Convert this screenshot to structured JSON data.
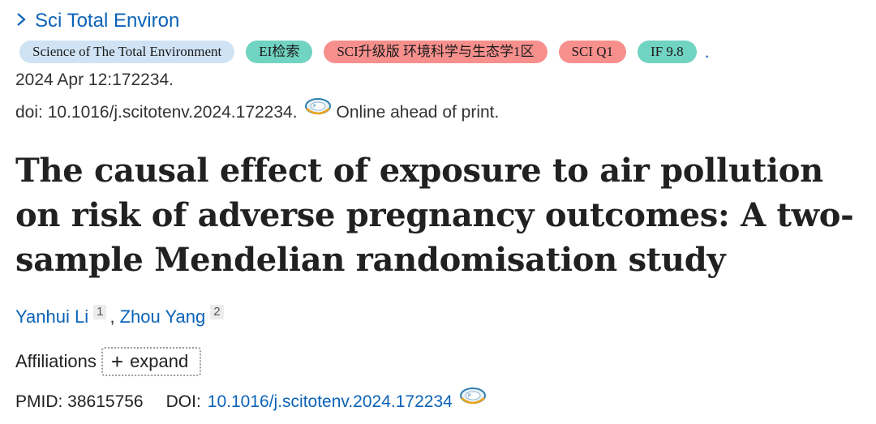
{
  "journal": {
    "short_name": "Sci Total Environ"
  },
  "badges": [
    {
      "label": "Science of The Total Environment",
      "color": "#cfe3f5"
    },
    {
      "label": "EI检索",
      "color": "#71d3c2"
    },
    {
      "label": "SCI升级版 环境科学与生态学1区",
      "color": "#f7908d"
    },
    {
      "label": "SCI Q1",
      "color": "#f7908d"
    },
    {
      "label": "IF 9.8",
      "color": "#71d3c2"
    }
  ],
  "badges_trailing": ".",
  "citation": {
    "date": "2024 Apr 12:172234.",
    "doi_text": "doi: 10.1016/j.scitotenv.2024.172234.",
    "status": "Online ahead of print."
  },
  "article": {
    "title": "The causal effect of exposure to air pollution on risk of adverse pregnancy outcomes: A two-sample Mendelian randomisation study"
  },
  "authors": [
    {
      "name": "Yanhui Li",
      "affiliation": "1"
    },
    {
      "name": "Zhou Yang",
      "affiliation": "2"
    }
  ],
  "author_separator": ",",
  "affiliations": {
    "label": "Affiliations",
    "expand_label": "expand",
    "expand_symbol": "+"
  },
  "identifiers": {
    "pmid": "PMID: 38615756",
    "doi_label": "DOI:",
    "doi_value": "10.1016/j.scitotenv.2024.172234"
  },
  "icons": {
    "journal_chevron": "chevron-right-icon",
    "fulltext": "fulltext-link-icon"
  },
  "colors": {
    "link": "#0b63b8",
    "text": "#212121"
  }
}
